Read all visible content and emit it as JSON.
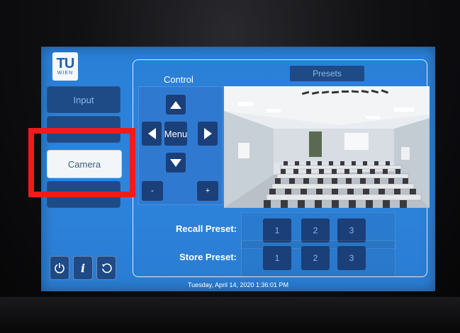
{
  "logo": {
    "line1": "TU",
    "line2": "WIEN"
  },
  "sidebar": {
    "items": [
      {
        "label": "Input"
      },
      {
        "label": ""
      },
      {
        "label": "Camera"
      },
      {
        "label": ""
      }
    ]
  },
  "control": {
    "title": "Control",
    "menu_label": "Menu",
    "zoom_out_label": "-",
    "zoom_in_label": "+"
  },
  "presets": {
    "tab_label": "Presets",
    "recall_label": "Recall Preset:",
    "store_label": "Store Preset:",
    "recall_buttons": [
      "1",
      "2",
      "3"
    ],
    "store_buttons": [
      "1",
      "2",
      "3"
    ]
  },
  "footer": {
    "datetime": "Tuesday, April 14, 2020 1:36:01 PM"
  },
  "icons": {
    "power": "power-icon",
    "info": "info-icon",
    "refresh": "refresh-icon"
  },
  "colors": {
    "screen": "#2a7fd6",
    "button": "#1b3f78",
    "highlight": "#ee1c1c"
  }
}
